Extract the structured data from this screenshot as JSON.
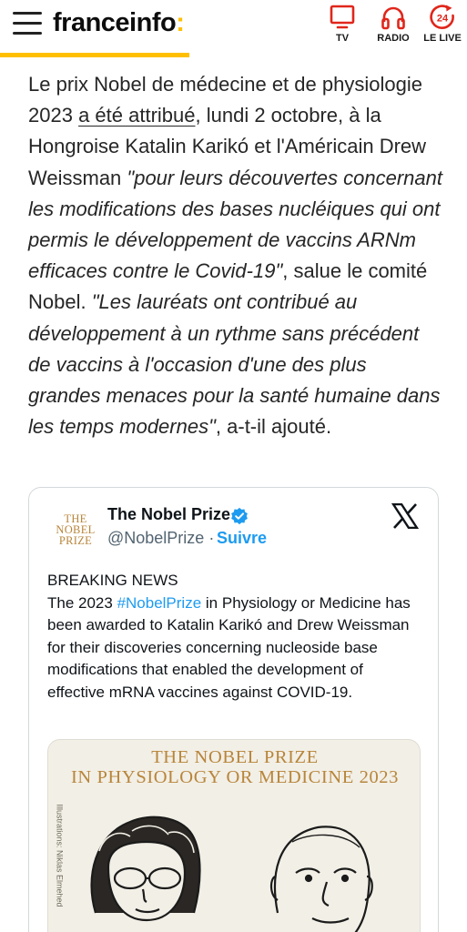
{
  "header": {
    "logo": "franceinfo",
    "logo_suffix": ":",
    "nav": [
      {
        "label": "TV",
        "icon": "tv-icon"
      },
      {
        "label": "RADIO",
        "icon": "headphones-icon"
      },
      {
        "label": "LE LIVE",
        "icon": "live-24-icon",
        "badge": "24"
      }
    ],
    "accent_color": "#ffbf00"
  },
  "article": {
    "p1": "Le prix Nobel de médecine et de physiologie 2023 ",
    "link": "a été attribué",
    "p2": ", lundi 2 octobre, à la Hongroise Katalin Karikó et l'Américain Drew Weissman ",
    "quote1": "\"pour leurs découvertes concernant les modifications des bases nucléiques qui ont permis le développement de vaccins ARNm efficaces contre le Covid-19\"",
    "p3": ", salue le comité Nobel. ",
    "quote2": "\"Les lauréats ont contribué au développement à un rythme sans précédent de vaccins à l'occasion d'une des plus grandes menaces pour la santé humaine dans les temps modernes\"",
    "p4": ", a-t-il ajouté."
  },
  "tweet": {
    "avatar_text": [
      "THE",
      "NOBEL",
      "PRIZE"
    ],
    "author_name": "The Nobel Prize",
    "handle": "@NobelPrize",
    "separator": "·",
    "follow_label": "Suivre",
    "body_line1": "BREAKING NEWS",
    "body_pre": "The 2023 ",
    "hashtag": "#NobelPrize",
    "body_post": " in Physiology or Medicine has been awarded to Katalin Karikó and Drew Weissman for their discoveries concerning nucleoside base modifications that enabled the development of effective mRNA vaccines against COVID-19.",
    "media_title_1": "THE NOBEL PRIZE",
    "media_title_2": "IN PHYSIOLOGY OR MEDICINE 2023",
    "media_credit": "Illustrations: Niklas Elmehed",
    "link_color": "#1d9bf0"
  }
}
